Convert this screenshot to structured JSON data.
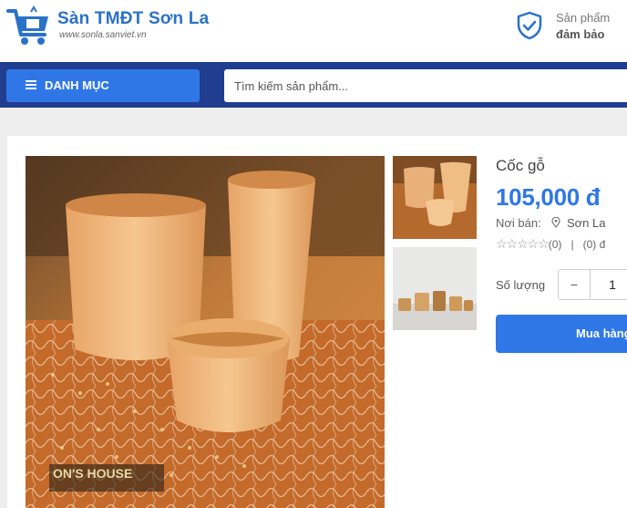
{
  "header": {
    "site_title": "Sàn TMĐT Sơn La",
    "site_url": "www.sonla.sanviet.vn",
    "guarantee_line1": "Sản phẩm",
    "guarantee_line2": "đảm bảo"
  },
  "navbar": {
    "menu_label": "DANH MỤC",
    "search_placeholder": "Tìm kiếm sản phẩm..."
  },
  "product": {
    "name": "Cốc gỗ",
    "price": "105,000 đ",
    "seller_label": "Nơi bán:",
    "seller_location": "Sơn La",
    "rating_text": "(0)",
    "rating_separator": "|",
    "review_count_text": "(0) đ",
    "quantity_label": "Số lượng",
    "quantity_value": "1",
    "minus_label": "−",
    "buy_label": "Mua hàng",
    "photo_watermark": "ON'S HOUSE"
  },
  "colors": {
    "brand_blue": "#2f77e7",
    "nav_dark": "#203d8f"
  },
  "icons": [
    "cart-logo-icon",
    "shield-check-icon",
    "hamburger-icon",
    "map-pin-icon",
    "star-outline-icon"
  ]
}
